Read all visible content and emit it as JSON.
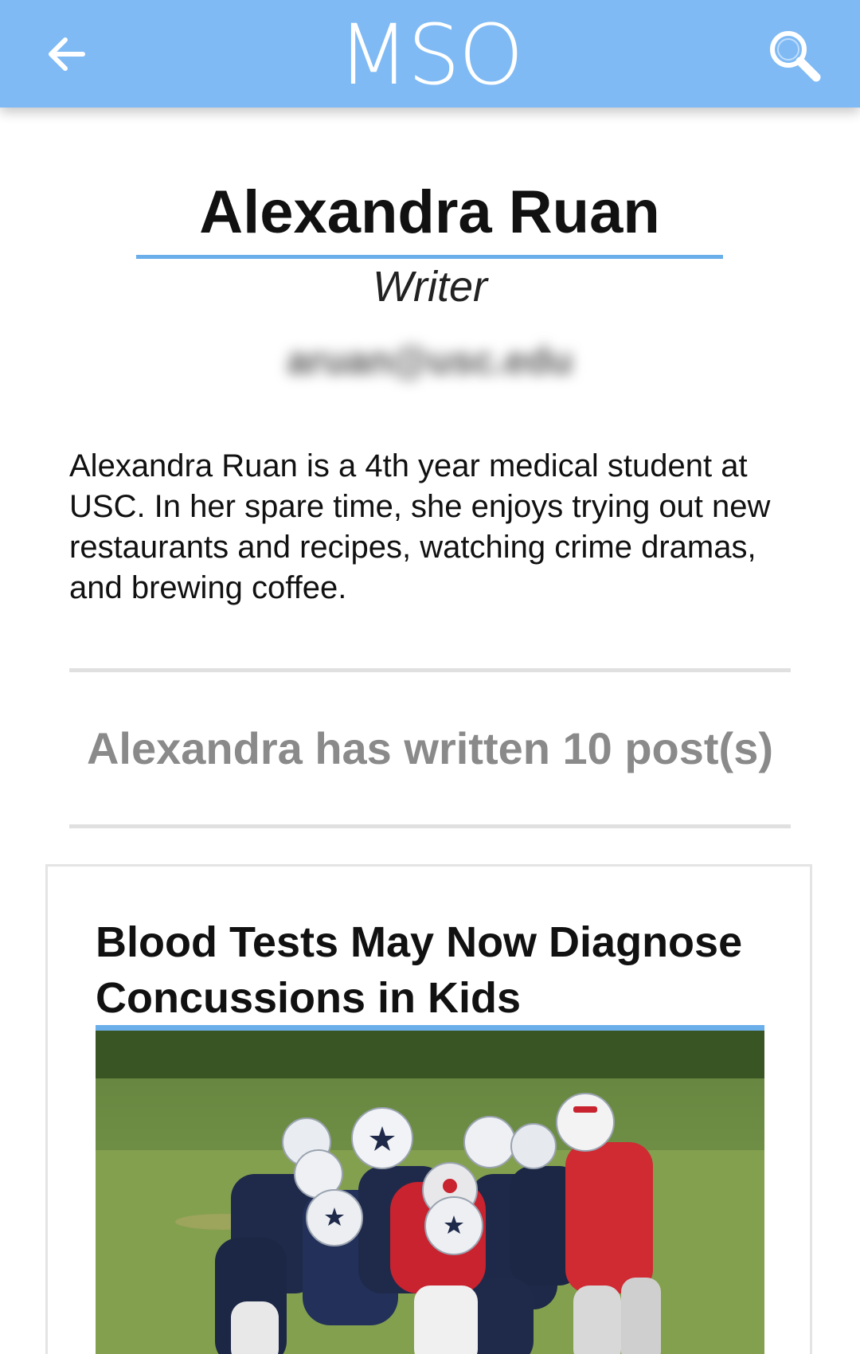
{
  "header": {
    "logo_text": "MSO",
    "back_icon": "arrow-left-icon",
    "search_icon": "search-icon",
    "background_color": "#7fbaf5"
  },
  "author": {
    "name": "Alexandra Ruan",
    "role": "Writer",
    "email": "aruan@usc.edu",
    "bio": "Alexandra Ruan is a 4th year medical student at USC. In her spare time, she enjoys trying out new restaurants and recipes, watching crime dramas, and brewing coffee."
  },
  "posts_summary": {
    "text": "Alexandra has written 10 post(s)"
  },
  "post": {
    "title": "Blood Tests May Now Diagnose Concussions in Kids",
    "image_description": "youth-football-tackle-photo"
  },
  "colors": {
    "accent": "#6aaeea",
    "divider": "#e0e0e0",
    "muted_text": "#8a8a8a"
  }
}
